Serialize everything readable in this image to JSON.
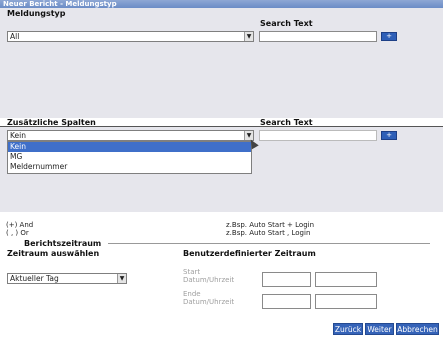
{
  "window": {
    "title": "Neuer Bericht - Meldungstyp"
  },
  "section1": {
    "meldungstyp_label": "Meldungstyp",
    "meldungstyp_value": "All",
    "search_label": "Search Text",
    "plus_label": "+"
  },
  "section2": {
    "spalten_label": "Zusätzliche Spalten",
    "spalten_value": "Kein",
    "search_label": "Search Text",
    "plus_label": "+",
    "options": [
      "Kein",
      "MG",
      "Meldernummer"
    ]
  },
  "operators": {
    "and_label": "(+) And",
    "or_label": "( , ) Or",
    "and_example": "z.Bsp. Auto Start + Login",
    "or_example": "z.Bsp. Auto Start , Login"
  },
  "berichtszeitraum": {
    "title": "Berichtszeitraum",
    "zeitraum_label": "Zeitraum auswählen",
    "zeitraum_value": "Aktueller Tag",
    "custom_label": "Benutzerdefinierter Zeitraum",
    "start_label1": "Start",
    "start_label2": "Datum/Uhrzeit",
    "ende_label1": "Ende",
    "ende_label2": "Datum/Uhrzeit"
  },
  "footer": {
    "zurueck": "Zurück",
    "weiter": "Weiter",
    "abbrechen": "Abbrechen"
  },
  "icons": {
    "dropdown_arrow": "chevron-down-icon",
    "cursor": "mouse-pointer-icon"
  },
  "colors": {
    "accent": "#2e5fb7",
    "selection": "#3f6fc9",
    "panel": "#e6e6ec"
  }
}
